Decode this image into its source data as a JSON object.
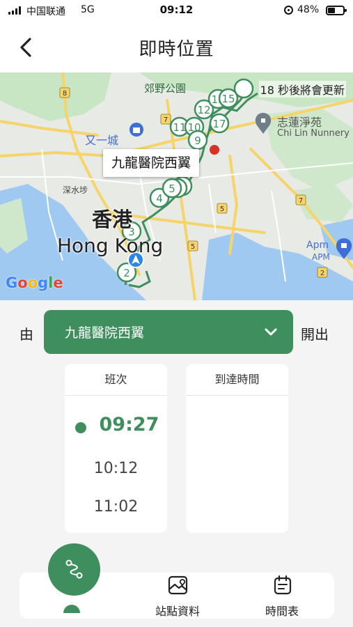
{
  "status_bar": {
    "carrier": "中国联通",
    "network": "5G",
    "time": "09:12",
    "battery": "48%",
    "icons": [
      "signal-icon",
      "orientation-lock-icon",
      "battery-icon"
    ]
  },
  "header": {
    "title": "即時位置",
    "back_icon": "chevron-left-icon"
  },
  "map": {
    "refresh_notice": "18 秒後將會更新",
    "selected_stop": "九龍醫院西翼",
    "labels": {
      "country_park": "郊野公園",
      "mall": "又一城",
      "nunnery_cn": "志蓮淨苑",
      "nunnery_en": "Chi Lin Nunnery",
      "district": "深水埗",
      "city_cn": "香港",
      "city_en": "Hong Kong",
      "apm_cn": "Apm",
      "apm_en": "APM"
    },
    "route_markers": [
      "2",
      "3",
      "4",
      "5",
      "9",
      "10",
      "11",
      "12",
      "13",
      "15",
      "17"
    ],
    "highway_shields": [
      "8",
      "7",
      "5",
      "5",
      "7",
      "2"
    ],
    "attribution": "Google",
    "route_color": "#3f8f5e"
  },
  "direction": {
    "from_label": "由",
    "selected_stop": "九龍醫院西翼",
    "to_label": "開出"
  },
  "schedule": {
    "columns": [
      "班次",
      "到達時間"
    ],
    "trips": [
      {
        "time": "09:27",
        "active": true
      },
      {
        "time": "10:12",
        "active": false
      },
      {
        "time": "11:02",
        "active": false
      }
    ]
  },
  "bottom_nav": {
    "items": [
      {
        "label": "",
        "icon": "route-icon",
        "active": true
      },
      {
        "label": "站點資料",
        "icon": "map-photo-icon"
      },
      {
        "label": "時間表",
        "icon": "timetable-icon"
      }
    ]
  },
  "colors": {
    "primary": "#3f8f5e",
    "background": "#f4f4f4"
  }
}
